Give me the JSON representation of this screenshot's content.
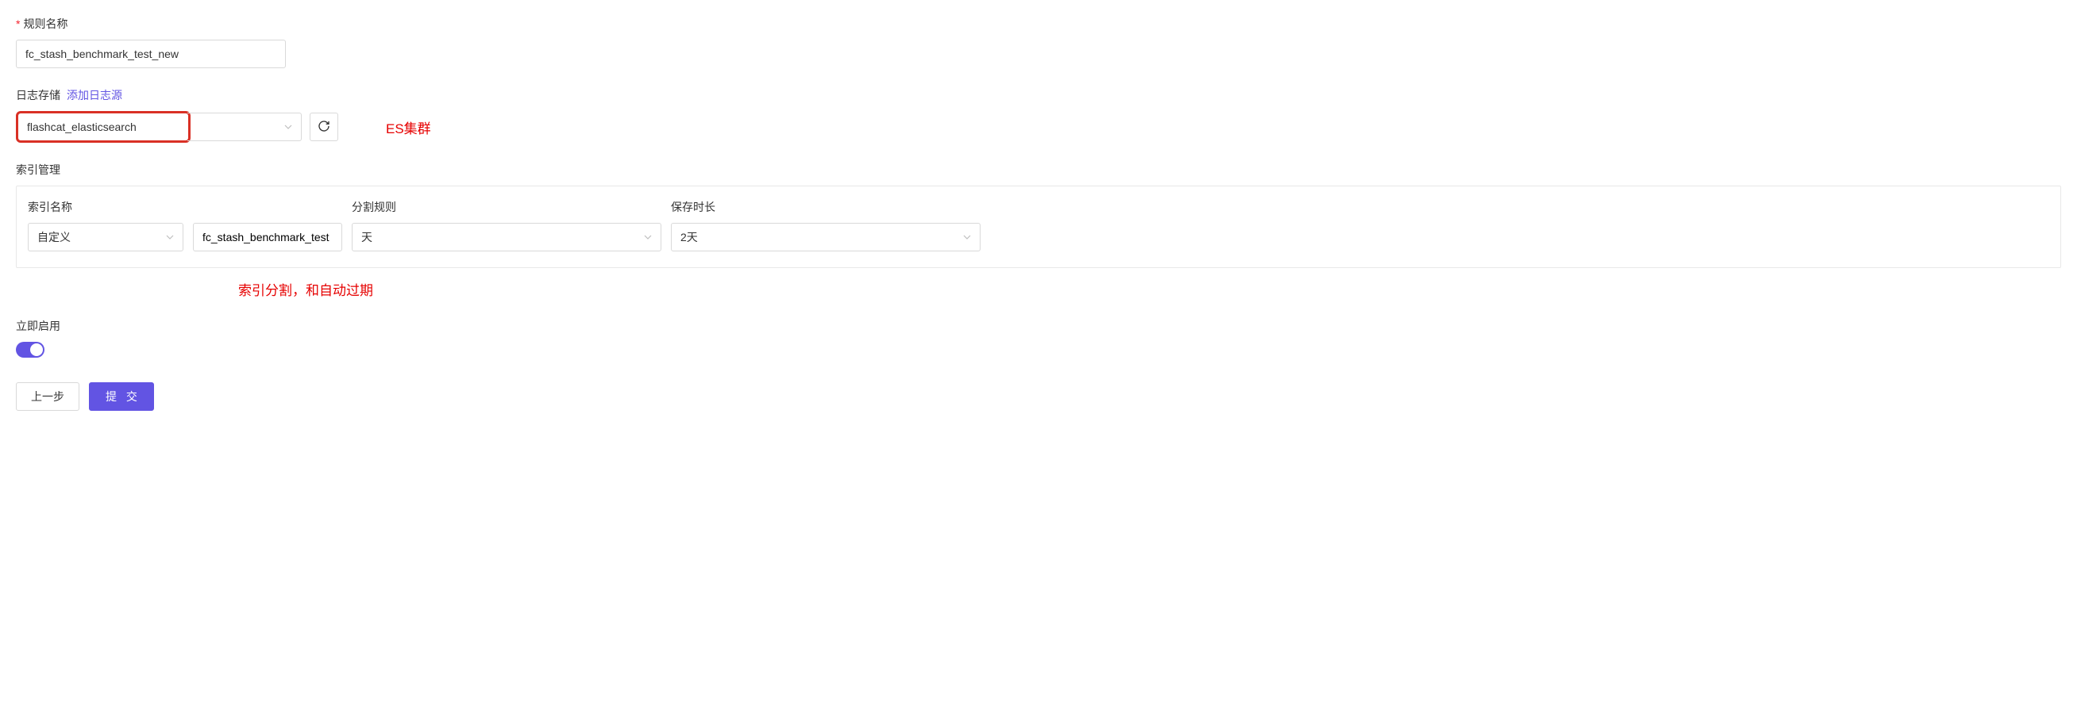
{
  "rule_name": {
    "label": "规则名称",
    "value": "fc_stash_benchmark_test_new"
  },
  "log_storage": {
    "label": "日志存储",
    "add_source_link": "添加日志源",
    "selected": "flashcat_elasticsearch",
    "annotation": "ES集群"
  },
  "index_mgmt": {
    "label": "索引管理",
    "columns": {
      "index_name": {
        "label": "索引名称",
        "type_selected": "自定义",
        "value": "fc_stash_benchmark_test"
      },
      "split_rule": {
        "label": "分割规则",
        "selected": "天"
      },
      "retention": {
        "label": "保存时长",
        "selected": "2天"
      }
    },
    "annotation": "索引分割，和自动过期"
  },
  "enable_now": {
    "label": "立即启用",
    "value": true
  },
  "buttons": {
    "prev": "上一步",
    "submit": "提 交"
  }
}
